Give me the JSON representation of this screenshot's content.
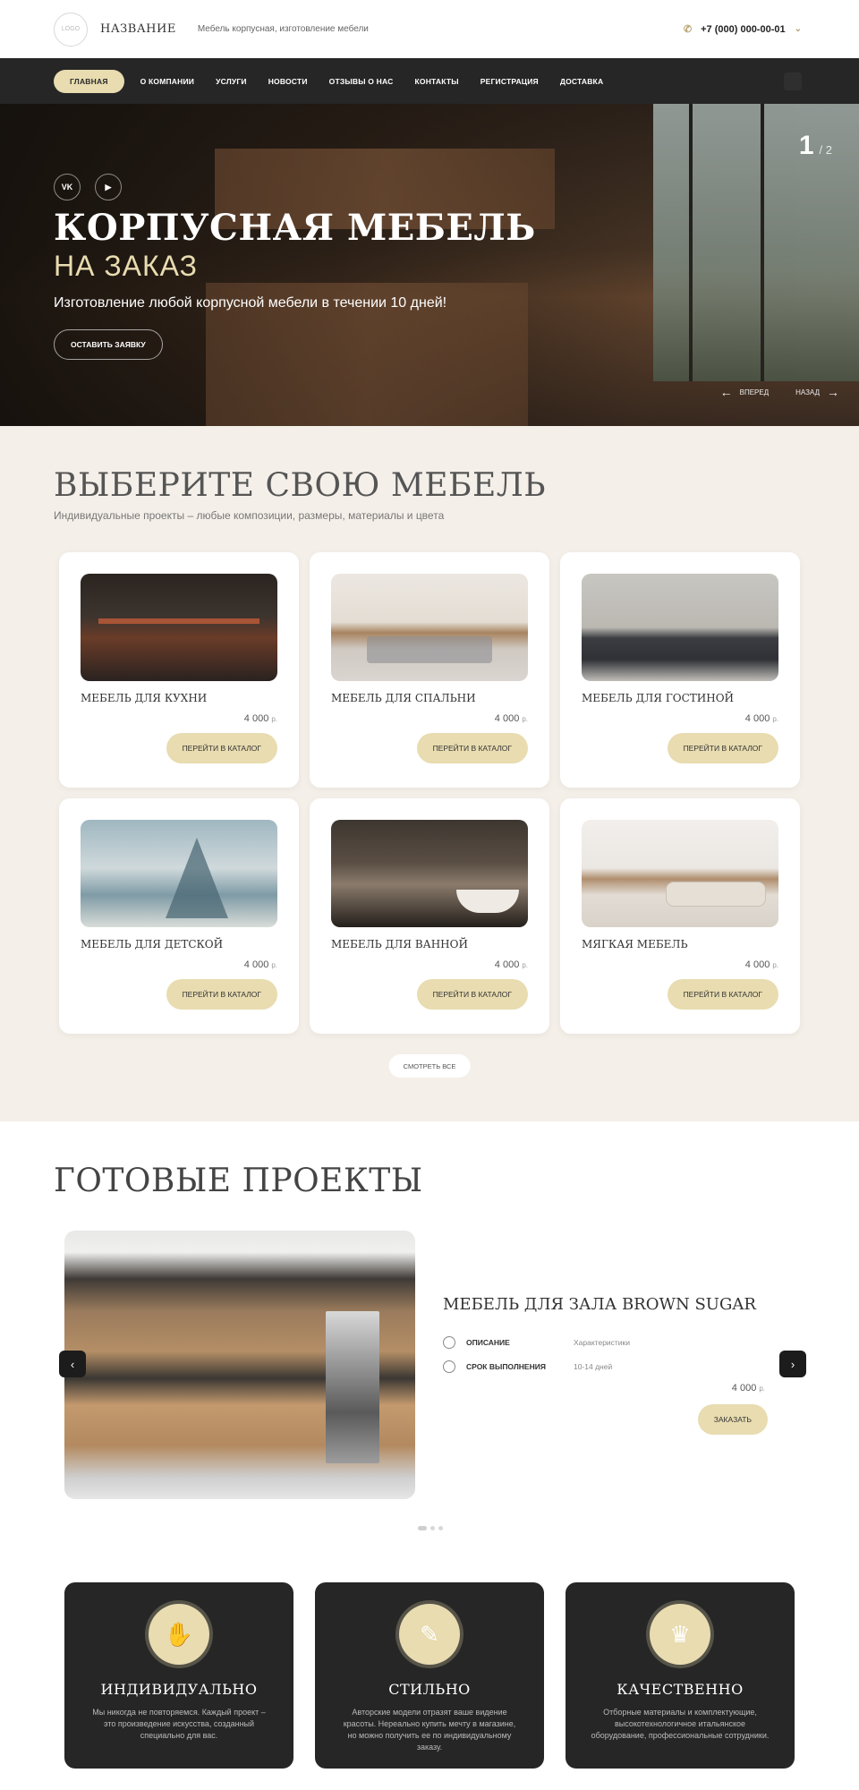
{
  "header": {
    "logo_text": "LOGO",
    "brand": "НАЗВАНИЕ",
    "tagline": "Мебель корпусная, изготовление мебели",
    "phone": "+7 (000) 000-00-01",
    "phone_icon": "phone-icon",
    "chevron_icon": "chevron-down-icon"
  },
  "nav": {
    "items": [
      "ГЛАВНАЯ",
      "О КОМПАНИИ",
      "УСЛУГИ",
      "НОВОСТИ",
      "ОТЗЫВЫ О НАС",
      "КОНТАКТЫ",
      "РЕГИСТРАЦИЯ",
      "ДОСТАВКА"
    ],
    "active_index": 0
  },
  "hero": {
    "slide_current": "1",
    "slide_total": "/ 2",
    "social_vk": "VK",
    "social_youtube": "▶",
    "title": "КОРПУСНАЯ МЕБЕЛЬ",
    "subtitle": "НА ЗАКАЗ",
    "lead": "Изготовление любой корпусной мебели в течении 10 дней!",
    "cta": "ОСТАВИТЬ ЗАЯВКУ",
    "prev_label": "ВПЕРЕД",
    "next_label": "НАЗАД"
  },
  "catalog": {
    "title": "ВЫБЕРИТЕ СВОЮ МЕБЕЛЬ",
    "subtitle": "Индивидуальные проекты – любые композиции, размеры, материалы и цвета",
    "cards": [
      {
        "name": "МЕБЕЛЬ ДЛЯ КУХНИ",
        "price": "4 000",
        "currency": "р.",
        "button": "ПЕРЕЙТИ В КАТАЛОГ"
      },
      {
        "name": "МЕБЕЛЬ ДЛЯ СПАЛЬНИ",
        "price": "4 000",
        "currency": "р.",
        "button": "ПЕРЕЙТИ В КАТАЛОГ"
      },
      {
        "name": "МЕБЕЛЬ ДЛЯ ГОСТИНОЙ",
        "price": "4 000",
        "currency": "р.",
        "button": "ПЕРЕЙТИ В КАТАЛОГ"
      },
      {
        "name": "МЕБЕЛЬ ДЛЯ ДЕТСКОЙ",
        "price": "4 000",
        "currency": "р.",
        "button": "ПЕРЕЙТИ В КАТАЛОГ"
      },
      {
        "name": "МЕБЕЛЬ ДЛЯ ВАННОЙ",
        "price": "4 000",
        "currency": "р.",
        "button": "ПЕРЕЙТИ В КАТАЛОГ"
      },
      {
        "name": "МЯГКАЯ МЕБЕЛЬ",
        "price": "4 000",
        "currency": "р.",
        "button": "ПЕРЕЙТИ В КАТАЛОГ"
      }
    ],
    "see_all": "СМОТРЕТЬ ВСЕ"
  },
  "projects": {
    "title": "ГОТОВЫЕ ПРОЕКТЫ",
    "item_title": "МЕБЕЛЬ ДЛЯ ЗАЛА BROWN SUGAR",
    "spec1_label": "ОПИСАНИЕ",
    "spec1_value": "Характеристики",
    "spec2_label": "СРОК ВЫПОЛНЕНИЯ",
    "spec2_value": "10-14 дней",
    "price": "4 000",
    "currency": "р.",
    "order": "ЗАКАЗАТЬ"
  },
  "features": [
    {
      "title": "ИНДИВИДУАЛЬНО",
      "text": "Мы никогда не повторяемся. Каждый проект – это произведение искусства, созданный специально для вас.",
      "icon": "handshake-icon"
    },
    {
      "title": "СТИЛЬНО",
      "text": "Авторские модели отразят ваше видение красоты. Нереально купить мечту в магазине, но можно получить ее по индивидуальному заказу.",
      "icon": "design-icon"
    },
    {
      "title": "КАЧЕСТВЕННО",
      "text": "Отборные материалы и комплектующие, высокотехнологичное итальянское оборудование, профессиональные сотрудники.",
      "icon": "trophy-icon"
    }
  ],
  "colors": {
    "accent": "#e8dcb0",
    "dark": "#262626",
    "section_bg": "#f4efe8"
  }
}
